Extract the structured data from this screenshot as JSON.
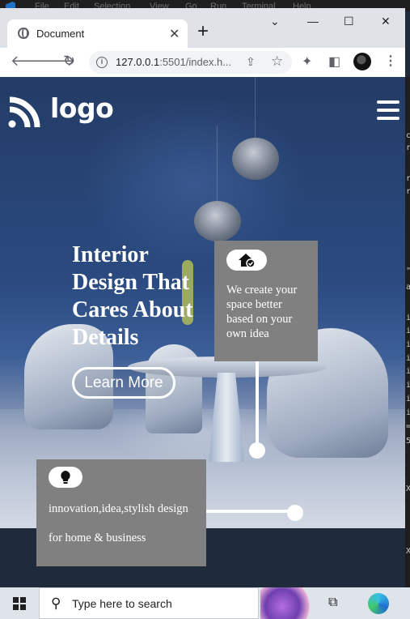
{
  "editor": {
    "menu": [
      "File",
      "Edit",
      "Selection",
      "View",
      "Go",
      "Run",
      "Terminal",
      "Help"
    ],
    "side_chars": [
      "c",
      "r",
      "r",
      "r",
      "\"",
      "a",
      "i",
      "i",
      "i",
      "i",
      "i",
      "i",
      "i",
      "i",
      "=",
      "5",
      "X",
      "X"
    ]
  },
  "browser": {
    "tab_title": "Document",
    "tab_close": "✕",
    "new_tab": "+",
    "url_host": "127.0.0.1",
    "url_rest": ":5501/index.h...",
    "window_controls": [
      "⌄",
      "—",
      "☐",
      "✕"
    ]
  },
  "site": {
    "logo_text": "logo",
    "headline": "Interior Design That Cares About Details",
    "cta_label": "Learn More",
    "card1_text": "We create your space better based on your own idea",
    "card2_text_line1": "innovation,idea,stylish design",
    "card2_text_line2": "for home & business"
  },
  "taskbar": {
    "search_placeholder": "Type here to search"
  },
  "colors": {
    "card_bg": "#808080",
    "hero_blue": "#2a4a80",
    "text_white": "#ffffff"
  },
  "icons": [
    "globe-icon",
    "back-arrow-icon",
    "forward-arrow-icon",
    "reload-icon",
    "info-icon",
    "share-icon",
    "star-icon",
    "extensions-icon",
    "sidepanel-icon",
    "avatar-icon",
    "menu-kebab-icon",
    "wifi-logo-icon",
    "hamburger-icon",
    "home-check-icon",
    "lightbulb-icon",
    "windows-logo-icon",
    "search-icon",
    "taskview-icon",
    "edge-icon"
  ]
}
